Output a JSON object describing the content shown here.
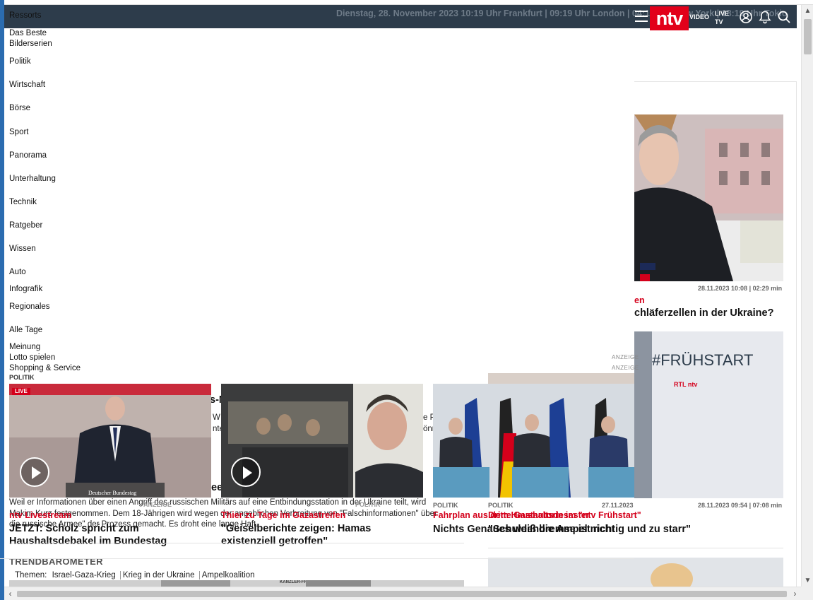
{
  "header": {
    "datebar": "Dienstag, 28. November 2023 10:19 Uhr Frankfurt | 09:19 Uhr London | 04:19 Uhr New York | 18:19 Uhr Tokio",
    "logo": "ntv",
    "video": "VIDEO",
    "live_tv_1": "LIVE",
    "live_tv_2": "TV"
  },
  "menu": {
    "heading": "Ressorts",
    "items": [
      "Das Beste",
      "Bilderserien",
      "Politik",
      "Wirtschaft",
      "Börse",
      "Sport",
      "Panorama",
      "Unterhaltung",
      "Technik",
      "Ratgeber",
      "Wissen",
      "Auto",
      "Infografik",
      "Regionales",
      "Alle Tage",
      "Meinung",
      "Lotto spielen",
      "Shopping & Service"
    ]
  },
  "right": {
    "video1_meta": "28.11.2023 10:08 | 02:29 min",
    "video1_kicker": "en",
    "video1_title": "chläferzellen in der Ukraine?",
    "video2_meta": "28.11.2023 09:54 | 07:08 min",
    "fruehstart_tag": "#FRÜHSTART",
    "fruehstart_sub": "RTL  ntv"
  },
  "ads": {
    "anzeige1": "ANZEIGE",
    "anzeige2": "ANZEIGE"
  },
  "articles": {
    "politik_tag": "POLITIK",
    "a1_live": "LIVE",
    "a1_kicker": "ntv Livestream",
    "a1_title": "JETZT: Scholz spricht zum Haushaltsdebakel im Bundestag",
    "a1_badge": "Deutscher Bundestag",
    "a2_kicker": "Thier zu Tage im Gazastreifen",
    "a2_title": "\"Geiselberichte zeigen: Hamas existenziell getroffen\"",
    "a3_tag": "POLITIK",
    "a3_kicker": "Fahrplan aus dem Haushaltsdesaster",
    "a3_title": "Nichts Genaues weiß die Ampel nicht",
    "a4_tag": "POLITIK",
    "a4_date": "27.11.2023",
    "a4_kicker": "Dritte Gastautorin im \"ntv Frühstart\"",
    "a4_title": "\"Schuldenbremse ist richtig und zu starr\"",
    "bg_text": "Weil er Informationen über einen Angriff des russischen Militärs auf eine Entbindungsstation in der Ukraine teilt, wird Makim Kurz festgenommen. Dem 18-Jährigen wird wegen der angeblichen Verbreitung von \"Falschinformationen\" über die russische Armee\" der Prozess gemacht. Es droht eine lange Haft.",
    "bg_snip1": "s-M",
    "bg_snip2": "W",
    "bg_snip3": "nte",
    "bg_snip4": "e P",
    "bg_snip5": "önm",
    "bg_snip6": "ee",
    "bg_label1": "ANZEIGE",
    "bg_label2": "POLITIK"
  },
  "trend": {
    "title": "TRENDBAROMETER",
    "themes_label": "Themen:",
    "themes": [
      "Israel-Gaza-Krieg",
      "Krieg in der Ukraine",
      "Ampelkoalition"
    ],
    "thumb_label": "KANZLER-FRAGE"
  }
}
